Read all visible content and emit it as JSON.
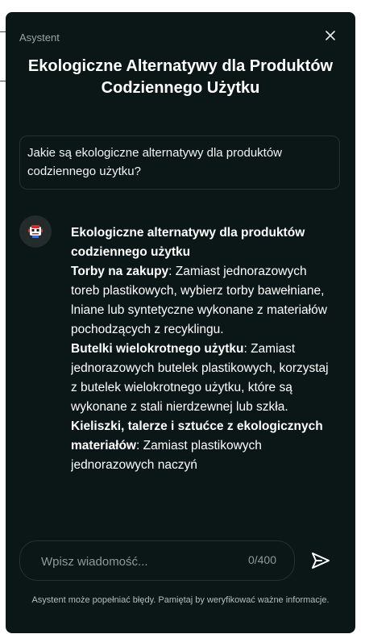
{
  "header": {
    "label": "Asystent",
    "close_symbol": "✕",
    "title": "Ekologiczne Alternatywy dla Produktów Codziennego Użytku"
  },
  "user_message": {
    "text": "Jakie są ekologiczne alternatywy dla produktów codziennego użytku?"
  },
  "bot_message": {
    "heading": "Ekologiczne alternatywy dla produktów codziennego użytku",
    "items": [
      {
        "title": "Torby na zakupy",
        "text": ": Zamiast jednorazowych toreb plastikowych, wybierz torby bawełniane, lniane lub syntetyczne wykonane z materiałów pochodzących z recyklingu."
      },
      {
        "title": "Butelki wielokrotnego użytku",
        "text": ": Zamiast jednorazowych butelek plastikowych, korzystaj z butelek wielokrotnego użytku, które są wykonane z stali nierdzewnej lub szkła."
      },
      {
        "title": "Kieliszki, talerze i sztućce z ekologicznych materiałów",
        "text": ": Zamiast plastikowych jednorazowych naczyń"
      }
    ]
  },
  "composer": {
    "placeholder": "Wpisz wiadomość...",
    "char_count": "0/400"
  },
  "footer": {
    "disclaimer": "Asystent może popełniać błędy. Pamiętaj by weryfikować ważne informacje."
  },
  "icons": {
    "close": "close-icon",
    "send": "send-icon",
    "avatar": "robot-icon"
  },
  "colors": {
    "panel_bg": "#0b1716",
    "text": "#ffffff",
    "muted": "#8f9a98",
    "border": "#243230"
  }
}
